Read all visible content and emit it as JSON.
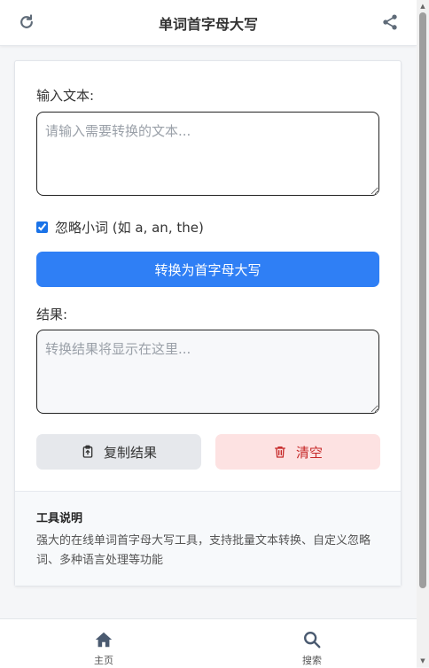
{
  "header": {
    "title": "单词首字母大写"
  },
  "form": {
    "input_label": "输入文本:",
    "input_placeholder": "请输入需要转换的文本...",
    "input_value": "",
    "ignore_small_words_label": "忽略小词 (如 a, an, the)",
    "ignore_small_words_checked": true,
    "convert_button": "转换为首字母大写",
    "result_label": "结果:",
    "result_placeholder": "转换结果将显示在这里...",
    "result_value": "",
    "copy_button": "复制结果",
    "clear_button": "清空"
  },
  "info": {
    "title": "工具说明",
    "description": "强大的在线单词首字母大写工具，支持批量文本转换、自定义忽略词、多种语言处理等功能"
  },
  "nav": {
    "items": [
      {
        "label": "主页",
        "icon": "home-icon"
      },
      {
        "label": "搜索",
        "icon": "search-icon"
      }
    ]
  },
  "colors": {
    "primary": "#2f7ff5",
    "danger_bg": "#fde2e2",
    "danger_text": "#c62828",
    "secondary_bg": "#e6e8ec"
  }
}
